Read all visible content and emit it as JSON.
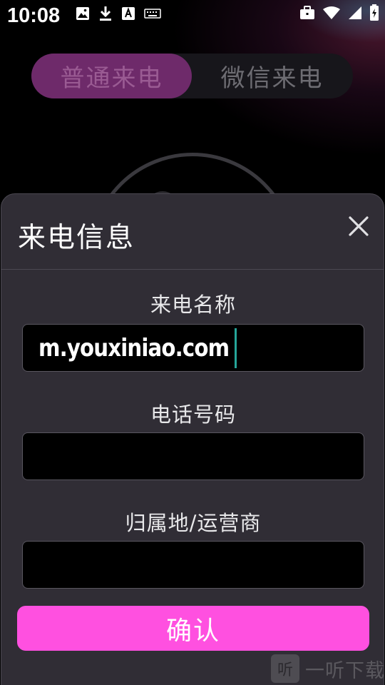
{
  "status_bar": {
    "time": "10:08",
    "left_icons": [
      "image-icon",
      "download-icon",
      "font-icon",
      "keyboard-icon"
    ],
    "right_icons": [
      "briefcase-icon",
      "wifi-icon",
      "signal-icon",
      "battery-charging-icon"
    ]
  },
  "tabs": [
    {
      "label": "普通来电",
      "active": true
    },
    {
      "label": "微信来电",
      "active": false
    }
  ],
  "sheet": {
    "title": "来电信息",
    "close_icon": "close-icon",
    "fields": {
      "name": {
        "label": "来电名称",
        "value": "m.youxiniao.com"
      },
      "phone": {
        "label": "电话号码",
        "value": ""
      },
      "location": {
        "label": "归属地/运营商",
        "value": ""
      }
    },
    "confirm_label": "确认"
  },
  "watermark": {
    "logo_text": "听",
    "text": "一听下载"
  },
  "colors": {
    "accent": "#ff50e0",
    "tab_active_bg": "#6e2a6a",
    "sheet_bg": "#302d35",
    "caret": "#26a69a"
  }
}
